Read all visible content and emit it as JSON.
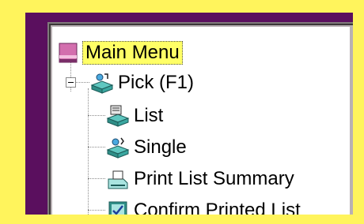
{
  "tree": {
    "root_label": "Main Menu",
    "items": [
      {
        "label": "Pick (F1)",
        "icon": "pick-icon"
      },
      {
        "label": "List",
        "icon": "list-icon"
      },
      {
        "label": "Single",
        "icon": "single-icon"
      },
      {
        "label": "Print List Summary",
        "icon": "print-icon"
      },
      {
        "label": "Confirm Printed List",
        "icon": "confirm-icon"
      }
    ]
  },
  "colors": {
    "frame_yellow": "#fff45c",
    "window_purple": "#5a0f5e",
    "selection_yellow": "#ffff66"
  }
}
